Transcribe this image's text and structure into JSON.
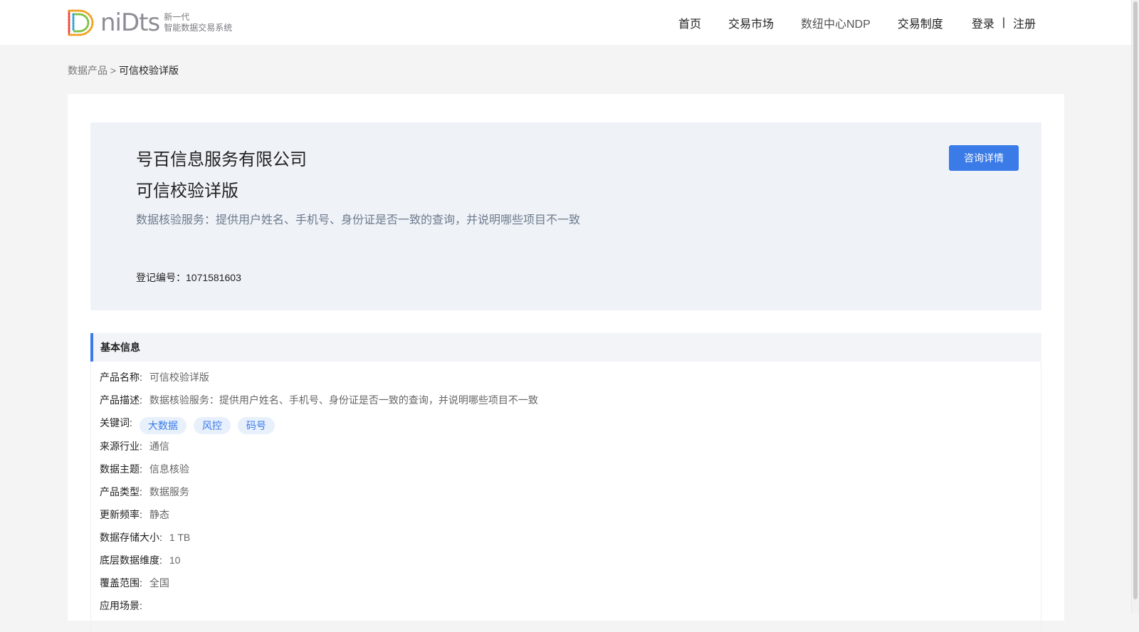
{
  "header": {
    "logo_text": "niDts",
    "logo_tagline_1": "新一代",
    "logo_tagline_2": "智能数据交易系统",
    "nav": [
      {
        "label": "首页"
      },
      {
        "label": "交易市场"
      },
      {
        "label": "数纽中心NDP"
      },
      {
        "label": "交易制度"
      }
    ],
    "login": "登录",
    "separator": "|",
    "register": "注册"
  },
  "breadcrumb": {
    "parent": "数据产品",
    "sep": " > ",
    "current": "可信校验详版"
  },
  "hero": {
    "company": "号百信息服务有限公司",
    "product": "可信校验详版",
    "description": "数据核验服务：提供用户姓名、手机号、身份证是否一致的查询，并说明哪些项目不一致",
    "reg_no": "登记编号：1071581603",
    "consult_label": "咨询详情"
  },
  "basic_info": {
    "title": "基本信息",
    "rows": [
      {
        "label": "产品名称:",
        "value": "可信校验详版"
      },
      {
        "label": "产品描述:",
        "value": "数据核验服务：提供用户姓名、手机号、身份证是否一致的查询，并说明哪些项目不一致"
      },
      {
        "label": "关键词:",
        "tags": [
          "大数据",
          "风控",
          "码号"
        ]
      },
      {
        "label": "来源行业:",
        "value": "通信"
      },
      {
        "label": "数据主题:",
        "value": "信息核验"
      },
      {
        "label": "产品类型:",
        "value": "数据服务"
      },
      {
        "label": "更新频率:",
        "value": "静态"
      },
      {
        "label": "数据存储大小:",
        "value": "1 TB"
      },
      {
        "label": "底层数据维度:",
        "value": "10"
      },
      {
        "label": "覆盖范围:",
        "value": "全国"
      },
      {
        "label": "应用场景:",
        "value": ""
      }
    ]
  },
  "colors": {
    "accent": "#3a7be8",
    "hero_bg": "#eff3f8",
    "page_bg": "#f4f4f4"
  }
}
